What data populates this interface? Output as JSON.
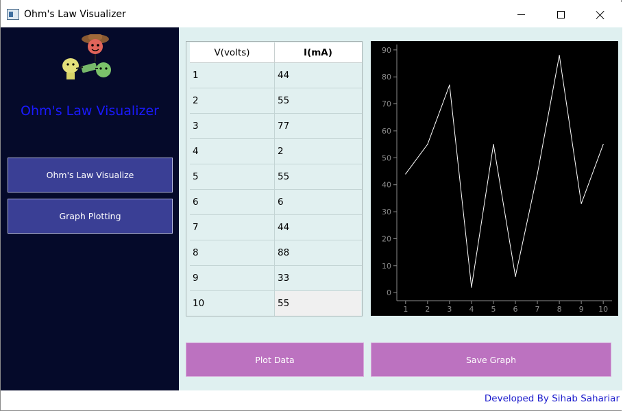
{
  "window": {
    "title": "Ohm's Law Visualizer"
  },
  "sidebar": {
    "title": "Ohm's Law Visualizer",
    "buttons": [
      {
        "label": "Ohm's Law Visualize"
      },
      {
        "label": "Graph Plotting"
      }
    ]
  },
  "table": {
    "headers": [
      "V(volts)",
      "I(mA)"
    ],
    "rows": [
      [
        "1",
        "44"
      ],
      [
        "2",
        "55"
      ],
      [
        "3",
        "77"
      ],
      [
        "4",
        "2"
      ],
      [
        "5",
        "55"
      ],
      [
        "6",
        "6"
      ],
      [
        "7",
        "44"
      ],
      [
        "8",
        "88"
      ],
      [
        "9",
        "33"
      ],
      [
        "10",
        "55"
      ]
    ]
  },
  "actions": {
    "plot_label": "Plot Data",
    "save_label": "Save Graph"
  },
  "footer": {
    "credit": "Developed By Sihab Sahariar"
  },
  "chart_data": {
    "type": "line",
    "x": [
      1,
      2,
      3,
      4,
      5,
      6,
      7,
      8,
      9,
      10
    ],
    "series": [
      {
        "values": [
          44,
          55,
          77,
          2,
          55,
          6,
          44,
          88,
          33,
          55
        ]
      }
    ],
    "xticks": [
      "1",
      "2",
      "3",
      "4",
      "5",
      "6",
      "7",
      "8",
      "9",
      "10"
    ],
    "yticks": [
      "0",
      "10",
      "20",
      "30",
      "40",
      "50",
      "60",
      "70",
      "80",
      "90"
    ],
    "xlim": [
      0.6,
      10.4
    ],
    "ylim": [
      -3,
      92
    ],
    "grid": false,
    "background": "#000000",
    "line_color": "#ffffff",
    "axis_color": "#8c8c8c"
  },
  "colors": {
    "sidebar_bg": "#050a2a",
    "sidebar_button": "#3a3f95",
    "sidebar_title": "#1a1aff",
    "main_bg": "#dff0f0",
    "action_button": "#bc72c0",
    "credit_text": "#1a1acc"
  }
}
